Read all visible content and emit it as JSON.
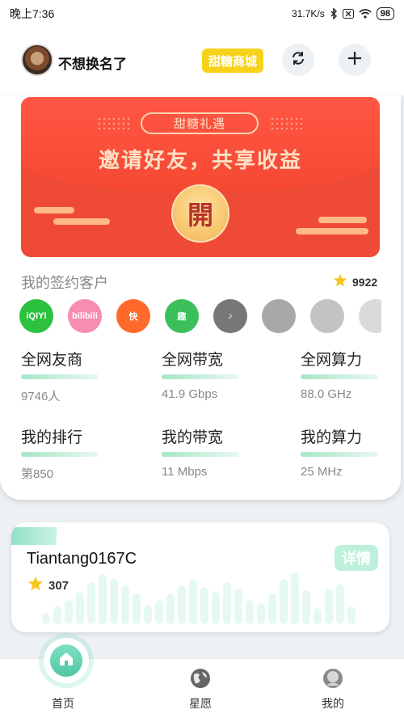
{
  "status_bar": {
    "time": "晚上7:36",
    "speed": "31.7K/s",
    "battery": "98"
  },
  "header": {
    "username": "不想换名了",
    "mall_button": "甜糖商城"
  },
  "banner": {
    "tag": "甜糖礼遇",
    "title": "邀请好友，共享收益",
    "open_label": "開"
  },
  "clients": {
    "title": "我的签约客户",
    "stars": "9922",
    "apps": [
      {
        "name": "iqiyi",
        "label": "iQIYI",
        "color": "#2cc13e"
      },
      {
        "name": "bilibili",
        "label": "bilibili",
        "color": "#f78db0"
      },
      {
        "name": "kuaishou",
        "label": "快",
        "color": "#ff6a2b"
      },
      {
        "name": "qu",
        "label": "趣",
        "color": "#3bbf5b"
      },
      {
        "name": "douyin",
        "label": "♪",
        "color": "#777777"
      },
      {
        "name": "app6",
        "label": "",
        "color": "#999999"
      },
      {
        "name": "app7",
        "label": "",
        "color": "#aaaaaa"
      },
      {
        "name": "app8",
        "label": "",
        "color": "#bbbbbb"
      }
    ]
  },
  "stats": {
    "net_friends": {
      "label": "全网友商",
      "value": "9746人"
    },
    "net_bandwidth": {
      "label": "全网带宽",
      "value": "41.9 Gbps"
    },
    "net_compute": {
      "label": "全网算力",
      "value": "88.0 GHz"
    },
    "my_rank": {
      "label": "我的排行",
      "value": "第850"
    },
    "my_bandwidth": {
      "label": "我的带宽",
      "value": "11 Mbps"
    },
    "my_compute": {
      "label": "我的算力",
      "value": "25 MHz"
    }
  },
  "device": {
    "name": "Tiantang0167C",
    "stars": "307",
    "detail_button": "详情"
  },
  "bottom_nav": {
    "home": "首页",
    "wish": "星愿",
    "mine": "我的"
  },
  "colors": {
    "accent_green": "#4ec7a3",
    "mall_yellow": "#f7d21a",
    "banner_red": "#f54833"
  }
}
